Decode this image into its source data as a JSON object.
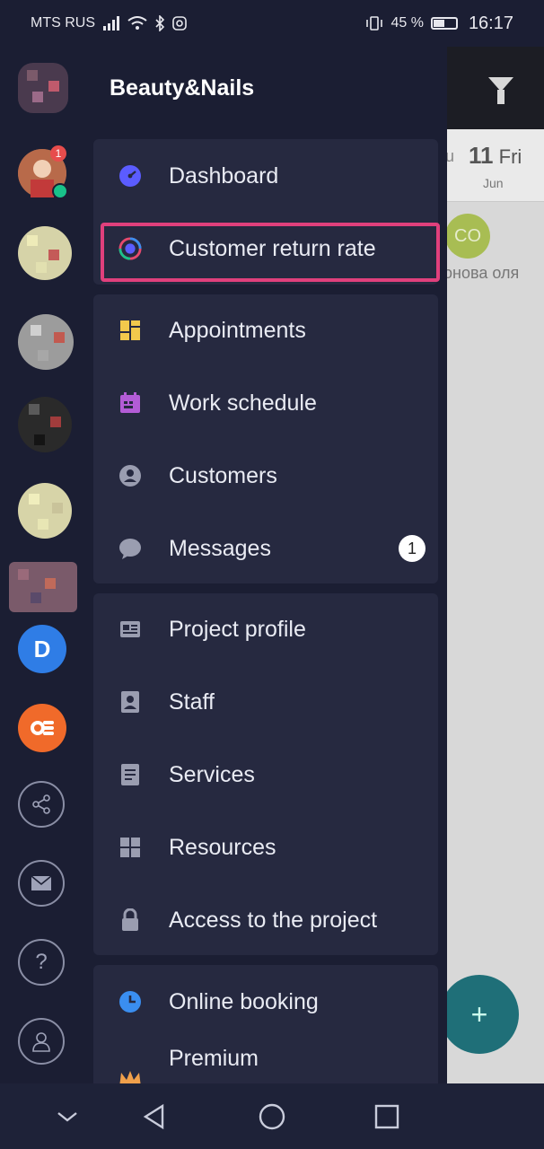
{
  "status_bar": {
    "carrier": "MTS RUS",
    "battery": "45 %",
    "time": "16:17"
  },
  "drawer": {
    "brand": "Beauty&Nails",
    "sections": [
      [
        {
          "label": "Dashboard",
          "icon": "dashboard-icon",
          "color": "#5b5cff"
        },
        {
          "label": "Customer return rate",
          "icon": "return-rate-icon",
          "color": "#e64a6f"
        }
      ],
      [
        {
          "label": "Appointments",
          "icon": "appointments-icon",
          "color": "#f2c94c"
        },
        {
          "label": "Work schedule",
          "icon": "calendar-icon",
          "color": "#b35cd6"
        },
        {
          "label": "Customers",
          "icon": "customer-icon",
          "color": "#9a9db0"
        },
        {
          "label": "Messages",
          "icon": "message-icon",
          "color": "#9a9db0",
          "badge": "1"
        }
      ],
      [
        {
          "label": "Project profile",
          "icon": "profile-card-icon",
          "color": "#9a9db0"
        },
        {
          "label": "Staff",
          "icon": "staff-icon",
          "color": "#9a9db0"
        },
        {
          "label": "Services",
          "icon": "services-icon",
          "color": "#9a9db0"
        },
        {
          "label": "Resources",
          "icon": "resources-icon",
          "color": "#9a9db0"
        },
        {
          "label": "Access to the project",
          "icon": "lock-icon",
          "color": "#9a9db0"
        }
      ],
      [
        {
          "label": "Online booking",
          "icon": "clock-icon",
          "color": "#3a8ef0"
        },
        {
          "label": "Premium",
          "icon": "crown-icon",
          "color": "#f0a04b"
        }
      ]
    ]
  },
  "background_app": {
    "day_number": "11",
    "day_name": "Fri",
    "month": "Jun",
    "day_partial": "u",
    "avatar_initials": "CO",
    "customer_name": "онова оля",
    "fab": "+"
  },
  "rail": {
    "avatar_badge": "1",
    "d_app_letter": "D"
  }
}
